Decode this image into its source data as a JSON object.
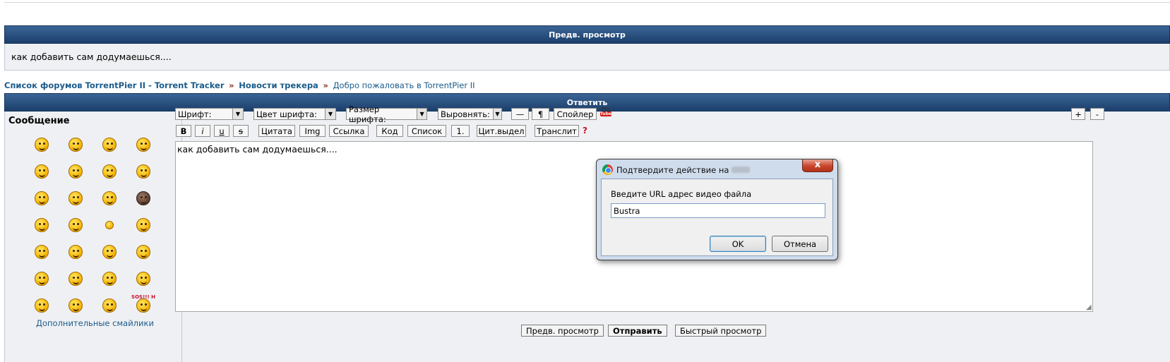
{
  "preview": {
    "header": "Предв. просмотр",
    "body": "как добавить сам додумаешься...."
  },
  "breadcrumb": {
    "forum_list": "Список форумов TorrentPier II - Torrent Tracker",
    "separator": "»",
    "section": "Новости трекера",
    "topic": "Добро пожаловать в TorrentPier II"
  },
  "reply": {
    "header": "Ответить",
    "message_label": "Сообщение",
    "more_smilies": "Дополнительные смайлики"
  },
  "toolbar": {
    "font": "Шрифт:",
    "font_color": "Цвет шрифта:",
    "font_size": "Размер шрифта:",
    "align": "Выровнять:",
    "hr": "—",
    "pilcrow": "¶",
    "spoiler": "Спойлер",
    "youtube_you": "You",
    "youtube_tube": "Tube",
    "bold": "B",
    "italic": "i",
    "underline": "u",
    "strike": "s",
    "quote": "Цитата",
    "img": "Img",
    "link": "Ссылка",
    "code": "Код",
    "list": "Список",
    "list_item": "1.",
    "quote_selected": "Цит.выдел",
    "translit": "Транслит",
    "help": "?",
    "plus": "+",
    "minus": "-"
  },
  "editor": {
    "text": "как добавить сам додумаешься...."
  },
  "actions": {
    "preview": "Предв. просмотр",
    "submit": "Отправить",
    "quick_preview": "Быстрый просмотр"
  },
  "dialog": {
    "title": "Подтвердите действие на",
    "close": "x",
    "prompt": "Введите URL адрес видео файла",
    "input_value": "Bustra",
    "ok": "OK",
    "cancel": "Отмена"
  },
  "smilies": {
    "icons": [
      "smiley-icon",
      "smiley-icon",
      "smiley-icon",
      "smiley-icon",
      "smiley-icon",
      "smiley-icon",
      "smiley-icon",
      "smiley-icon",
      "smiley-icon",
      "smiley-icon",
      "smiley-icon",
      "dark-smiley-icon",
      "smiley-icon",
      "smiley-icon",
      "small-smiley-icon",
      "smiley-icon",
      "smiley-icon",
      "smiley-icon",
      "exclamation-smiley-icon",
      "arrow-smiley-icon",
      "smiley-icon",
      "smiley-icon",
      "smiley-icon",
      "smiley-icon",
      "sign-smiley-icon",
      "smiley-icon",
      "smiley-icon",
      "sos-smiley-icon"
    ],
    "sos_text": "SOS!!! H"
  },
  "colors": {
    "header_bar": "#1c3f6c",
    "panel_bg": "#eff0f3",
    "link": "#1b5b8b",
    "youtube_red": "#d4130f"
  }
}
